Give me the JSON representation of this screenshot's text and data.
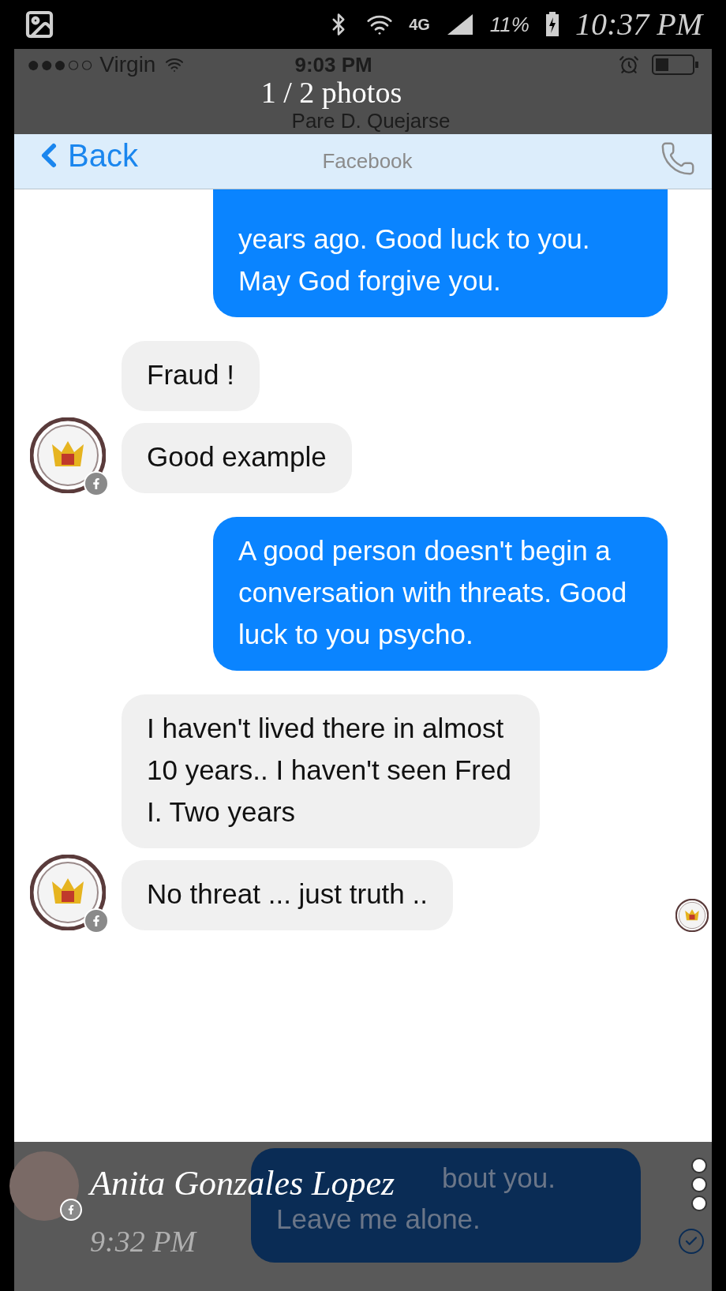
{
  "device_status": {
    "network": "4G",
    "battery": "11%",
    "time": "10:37 PM"
  },
  "viewer": {
    "title": "1 / 2 photos",
    "sender": "Anita Gonzales Lopez",
    "time": "9:32 PM"
  },
  "screenshot": {
    "status": {
      "carrier": "●●●○○ Virgin",
      "time": "9:03 PM"
    },
    "header": {
      "back": "Back",
      "title": "Pare D. Quejarse",
      "subtitle": "Facebook"
    },
    "messages": [
      {
        "kind": "sent",
        "text": "years ago. Good luck to you. May God forgive you.",
        "avatar": false
      },
      {
        "kind": "received",
        "text": "Fraud !",
        "avatar": false
      },
      {
        "kind": "received",
        "text": "Good example",
        "avatar": true
      },
      {
        "kind": "sent",
        "text": "A good person doesn't begin a conversation with threats. Good luck to you psycho.",
        "avatar": false
      },
      {
        "kind": "received",
        "text": "I haven't lived there in almost 10 years.. I haven't seen Fred I. Two years",
        "avatar": false
      },
      {
        "kind": "received",
        "text": "No threat ... just truth ..",
        "avatar": true
      }
    ],
    "last_message": {
      "lines": [
        "bout you.",
        "Leave me alone."
      ]
    }
  }
}
